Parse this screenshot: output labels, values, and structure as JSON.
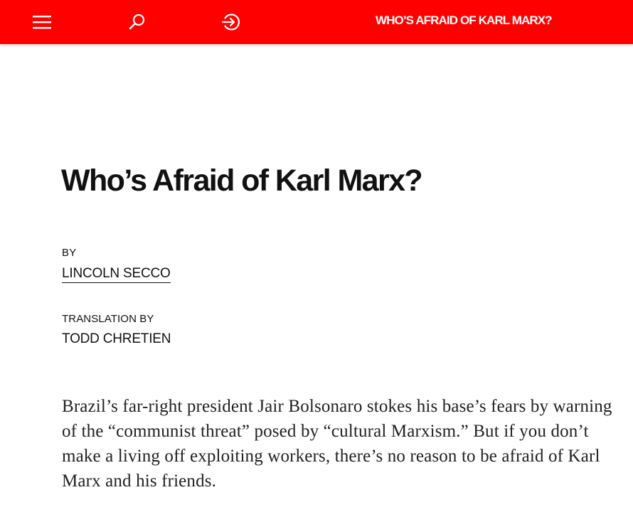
{
  "header": {
    "menu_icon": "hamburger-menu-icon",
    "search_icon": "search-icon",
    "login_icon": "sign-in-icon",
    "masthead_title": "WHO’S AFRAID OF KARL MARX?",
    "background_color": "#ff0000",
    "text_color": "#ffffff"
  },
  "article": {
    "title": "Who’s Afraid of Karl Marx?",
    "byline_label": "BY",
    "author": "LINCOLN SECCO",
    "translation_label": "TRANSLATION BY",
    "translator": "TODD CHRETIEN",
    "dek": "Brazil’s far-right president Jair Bolsonaro stokes his base’s fears by warning of the “communist threat” posed by “cultural Marxism.” But if you don’t make a living off exploiting workers, there’s no reason to be afraid of Karl Marx and his friends."
  }
}
